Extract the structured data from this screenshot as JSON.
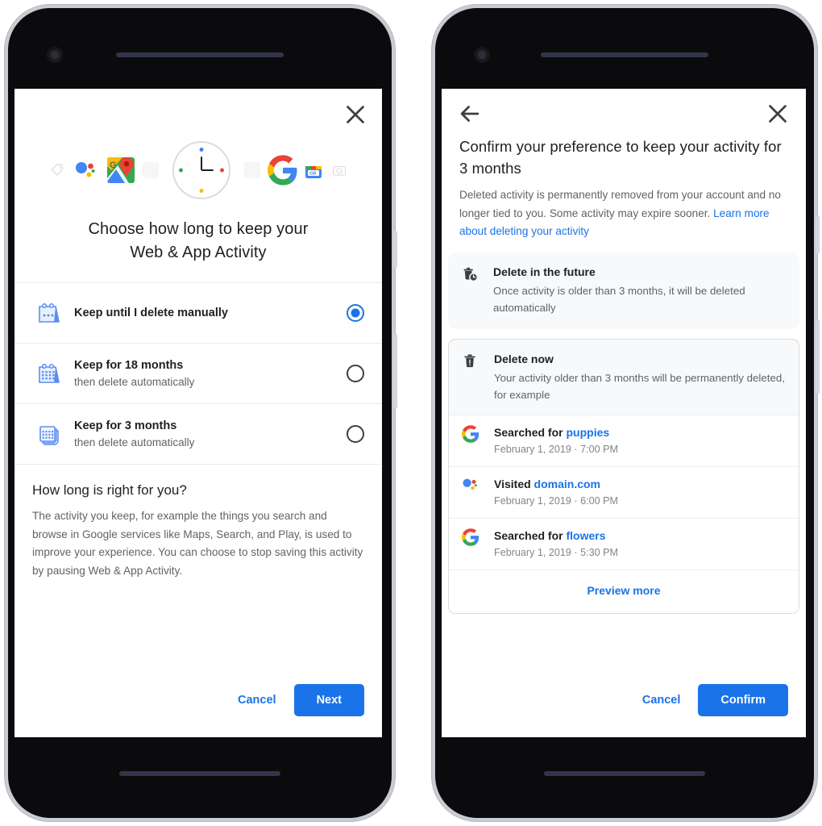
{
  "left_phone": {
    "close_icon": "close-icon",
    "hero": {
      "icons": [
        "tag-icon",
        "assistant-dots-icon",
        "google-maps-icon",
        "clock-icon",
        "google-g-icon",
        "google-play-icon",
        "camera-icon"
      ]
    },
    "heading_line1": "Choose how long to keep your",
    "heading_line2": "Web & App Activity",
    "options": [
      {
        "icon": "calendar-dots-icon",
        "title": "Keep until I delete manually",
        "subtitle": "",
        "selected": true
      },
      {
        "icon": "calendar-grid-icon",
        "title": "Keep for 18 months",
        "subtitle": "then delete automatically",
        "selected": false
      },
      {
        "icon": "calendar-stack-icon",
        "title": "Keep for 3 months",
        "subtitle": "then delete automatically",
        "selected": false
      }
    ],
    "info": {
      "heading": "How long is right for you?",
      "paragraph": "The activity you keep, for example the things you search and browse in Google services like Maps, Search, and Play, is used to improve your experience. You can choose to stop saving this activity by pausing Web & App Activity."
    },
    "actions": {
      "cancel_label": "Cancel",
      "primary_label": "Next"
    }
  },
  "right_phone": {
    "back_icon": "back-arrow-icon",
    "close_icon": "close-icon",
    "title": "Confirm your preference to keep your activity for 3 months",
    "subtitle_text": "Deleted activity is permanently removed from your account and no longer tied to you. Some activity may expire sooner. ",
    "subtitle_link": "Learn more about deleting your activity",
    "future_card": {
      "icon": "delete-clock-icon",
      "title": "Delete in the future",
      "description": "Once activity is older than 3 months, it will be deleted automatically"
    },
    "now_card": {
      "icon": "trash-icon",
      "title": "Delete now",
      "description": "Your activity older than 3 months will be permanently deleted, for example"
    },
    "activities": [
      {
        "icon": "google-g-icon",
        "prefix": "Searched for ",
        "query": "puppies",
        "time": "February 1, 2019 · 7:00 PM"
      },
      {
        "icon": "assistant-dots-icon",
        "prefix": "Visited ",
        "query": "domain.com",
        "time": "February 1, 2019 · 6:00 PM"
      },
      {
        "icon": "google-g-icon",
        "prefix": "Searched for ",
        "query": "flowers",
        "time": "February 1, 2019 · 5:30 PM"
      }
    ],
    "preview_more_label": "Preview more",
    "actions": {
      "cancel_label": "Cancel",
      "primary_label": "Confirm"
    }
  },
  "colors": {
    "accent_blue": "#1a73e8",
    "google_blue": "#4285f4",
    "google_red": "#ea4335",
    "google_yellow": "#fbbc04",
    "google_green": "#34a853",
    "text_primary": "#202124",
    "text_secondary": "#5f6368",
    "card_bg": "#f8f9fa"
  }
}
